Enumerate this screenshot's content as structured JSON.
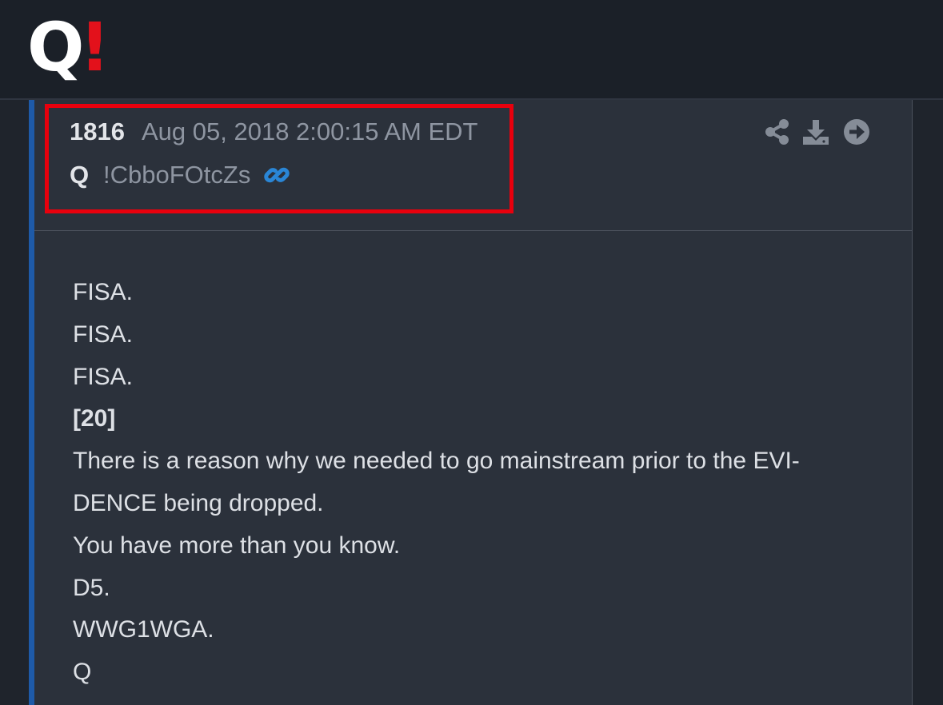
{
  "header": {
    "logo": {
      "letter": "Q",
      "mark": "!",
      "letter_color": "#ffffff",
      "mark_color": "#e3111b"
    }
  },
  "post": {
    "number": "1816",
    "date": "Aug 05, 2018 2:00:15 AM EDT",
    "author": "Q",
    "tripcode": "!CbboFOtcZs",
    "icons": [
      "link-icon",
      "share-icon",
      "download-icon",
      "next-icon"
    ],
    "accent_color": "#1e5aa8",
    "highlight_color": "#e8000d",
    "lines": [
      "FISA.",
      "FISA.",
      "FISA.",
      "[20]",
      "There is a reason why we needed to go mainstream prior to the EVI-",
      "DENCE being dropped.",
      "You have more than you know.",
      "D5.",
      "WWG1WGA.",
      "Q"
    ]
  }
}
